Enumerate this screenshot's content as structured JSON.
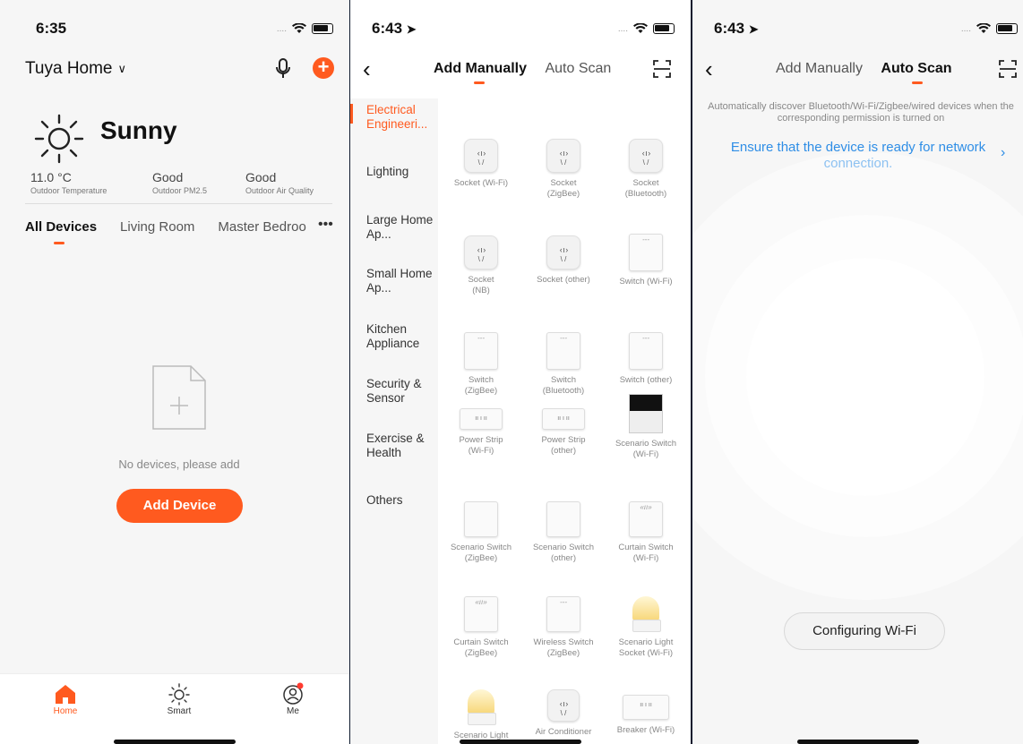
{
  "screen1": {
    "time": "6:35",
    "home_title": "Tuya Home",
    "weather": "Sunny",
    "stats": [
      {
        "value": "11.0 °C",
        "label": "Outdoor Temperature"
      },
      {
        "value": "Good",
        "label": "Outdoor PM2.5"
      },
      {
        "value": "Good",
        "label": "Outdoor Air Quality"
      }
    ],
    "room_tabs": [
      "All Devices",
      "Living Room",
      "Master Bedroo"
    ],
    "empty_text": "No devices, please add",
    "add_device": "Add Device",
    "tabbar": [
      "Home",
      "Smart",
      "Me"
    ]
  },
  "screen2": {
    "time": "6:43",
    "tab_manual": "Add Manually",
    "tab_auto": "Auto Scan",
    "categories": [
      "Electrical Engineeri...",
      "Lighting",
      "Large Home Ap...",
      "Small Home Ap...",
      "Kitchen Appliance",
      "Security & Sensor",
      "Exercise & Health",
      "Others"
    ],
    "devices": [
      "Socket (Wi-Fi)",
      "Socket\n(ZigBee)",
      "Socket\n(Bluetooth)",
      "Socket\n(NB)",
      "Socket (other)",
      "Switch (Wi-Fi)",
      "Switch\n(ZigBee)",
      "Switch\n(Bluetooth)",
      "Switch (other)",
      "Power Strip\n(Wi-Fi)",
      "Power Strip\n(other)",
      "Scenario Switch\n(Wi-Fi)",
      "Scenario Switch\n(ZigBee)",
      "Scenario Switch\n(other)",
      "Curtain Switch\n(Wi-Fi)",
      "Curtain Switch\n(ZigBee)",
      "Wireless Switch\n(ZigBee)",
      "Scenario Light\nSocket (Wi-Fi)",
      "Scenario Light",
      "Air Conditioner",
      "Breaker (Wi-Fi)"
    ]
  },
  "screen3": {
    "time": "6:43",
    "tab_manual": "Add Manually",
    "tab_auto": "Auto Scan",
    "description": "Automatically discover Bluetooth/Wi-Fi/Zigbee/wired devices when the corresponding permission is turned on",
    "link": "Ensure that the device is ready for network connection.",
    "config_button": "Configuring Wi-Fi"
  },
  "colors": {
    "accent": "#ff5a1f",
    "link": "#2f8ee6"
  }
}
